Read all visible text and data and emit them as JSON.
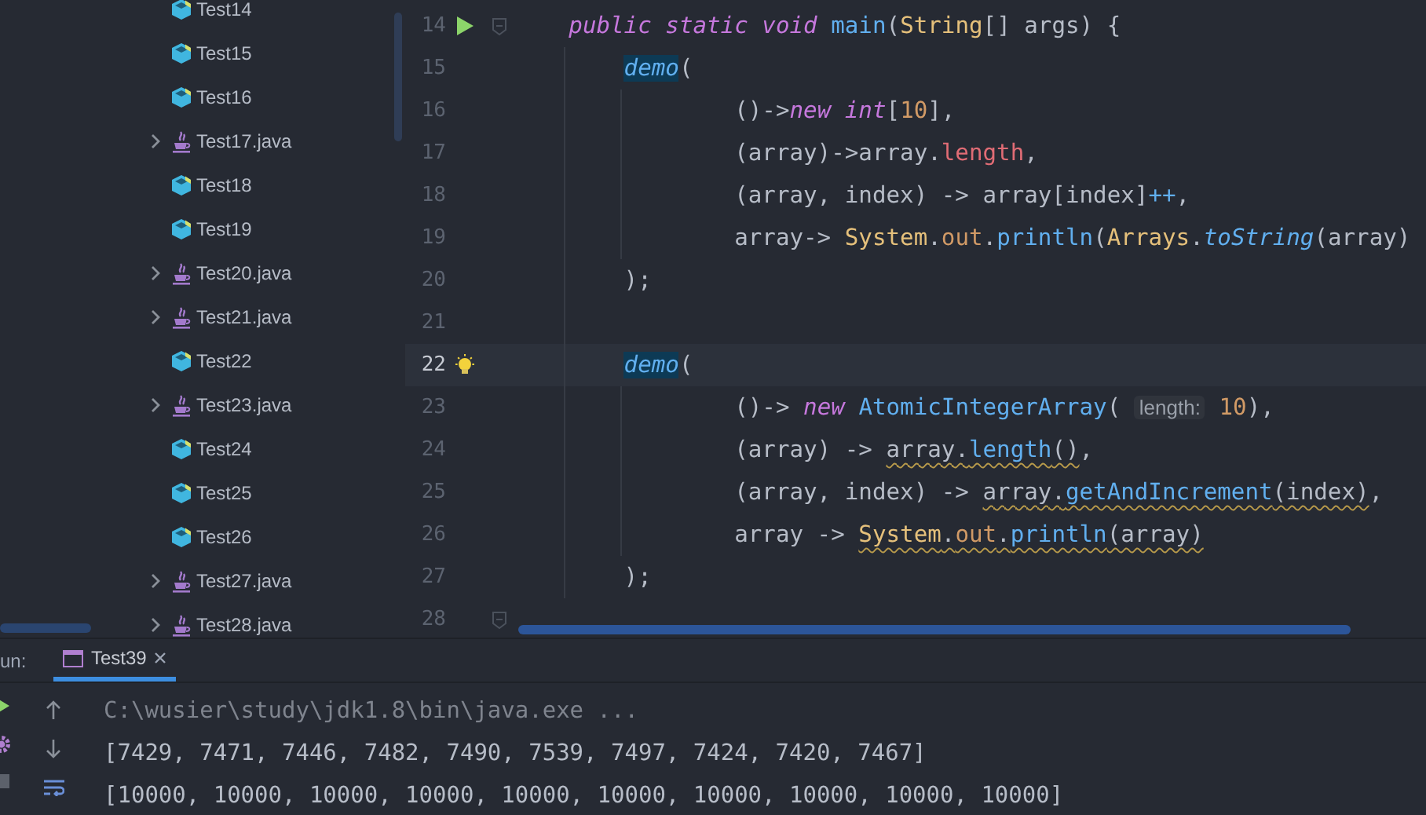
{
  "project_tree": {
    "items": [
      {
        "label": "Test14",
        "kind": "class",
        "expandable": false
      },
      {
        "label": "Test15",
        "kind": "class",
        "expandable": false
      },
      {
        "label": "Test16",
        "kind": "class",
        "expandable": false
      },
      {
        "label": "Test17.java",
        "kind": "java-file",
        "expandable": true
      },
      {
        "label": "Test18",
        "kind": "class",
        "expandable": false
      },
      {
        "label": "Test19",
        "kind": "class",
        "expandable": false
      },
      {
        "label": "Test20.java",
        "kind": "java-file",
        "expandable": true
      },
      {
        "label": "Test21.java",
        "kind": "java-file",
        "expandable": true
      },
      {
        "label": "Test22",
        "kind": "class",
        "expandable": false
      },
      {
        "label": "Test23.java",
        "kind": "java-file",
        "expandable": true
      },
      {
        "label": "Test24",
        "kind": "class",
        "expandable": false
      },
      {
        "label": "Test25",
        "kind": "class",
        "expandable": false
      },
      {
        "label": "Test26",
        "kind": "class",
        "expandable": false
      },
      {
        "label": "Test27.java",
        "kind": "java-file",
        "expandable": true
      },
      {
        "label": "Test28.java",
        "kind": "java-file",
        "expandable": true
      }
    ]
  },
  "editor": {
    "lines": [
      {
        "number": "14",
        "current": false,
        "gutter_icon": {
          "kind": "run"
        },
        "fold": true,
        "tokens": [
          {
            "text": "    public static void",
            "kind": "keyword"
          },
          {
            "text": " main",
            "kind": "method"
          },
          {
            "text": "("
          },
          {
            "text": "String",
            "kind": "type"
          },
          {
            "text": "[] args) {"
          }
        ]
      },
      {
        "number": "15",
        "current": false,
        "fold": false,
        "tokens": [
          {
            "text": "        demo",
            "kind": "static-method",
            "highlighted": true
          },
          {
            "text": "("
          }
        ]
      },
      {
        "number": "16",
        "current": false,
        "fold": false,
        "tokens": [
          {
            "text": "                ()->"
          },
          {
            "text": "new int",
            "kind": "keyword"
          },
          {
            "text": "["
          },
          {
            "text": "10",
            "kind": "number"
          },
          {
            "text": "],"
          }
        ]
      },
      {
        "number": "17",
        "current": false,
        "fold": false,
        "tokens": [
          {
            "text": "                (array)->array."
          },
          {
            "text": "length",
            "kind": "field"
          },
          {
            "text": ","
          }
        ]
      },
      {
        "number": "18",
        "current": false,
        "fold": false,
        "tokens": [
          {
            "text": "                (array, index) -> array[index]"
          },
          {
            "text": "++",
            "kind": "method"
          },
          {
            "text": ","
          }
        ]
      },
      {
        "number": "19",
        "current": false,
        "fold": false,
        "tokens": [
          {
            "text": "                array-> "
          },
          {
            "text": "System",
            "kind": "type"
          },
          {
            "text": "."
          },
          {
            "text": "out",
            "kind": "static-field"
          },
          {
            "text": "."
          },
          {
            "text": "println",
            "kind": "method"
          },
          {
            "text": "("
          },
          {
            "text": "Arrays",
            "kind": "type"
          },
          {
            "text": "."
          },
          {
            "text": "toString",
            "kind": "static-method"
          },
          {
            "text": "(array)"
          }
        ]
      },
      {
        "number": "20",
        "current": false,
        "fold": false,
        "tokens": [
          {
            "text": "        );"
          }
        ]
      },
      {
        "number": "21",
        "current": false,
        "fold": false
      },
      {
        "number": "22",
        "current": true,
        "gutter_icon": {
          "kind": "bulb"
        },
        "fold": false,
        "tokens": [
          {
            "text": "        demo",
            "kind": "static-method",
            "highlighted": true
          },
          {
            "text": "("
          }
        ]
      },
      {
        "number": "23",
        "current": false,
        "fold": false,
        "tokens": [
          {
            "text": "                ()-> "
          },
          {
            "text": "new ",
            "kind": "keyword"
          },
          {
            "text": "AtomicIntegerArray",
            "kind": "method"
          },
          {
            "text": "( "
          },
          {
            "text": "length:",
            "kind": "hint"
          },
          {
            "text": " 10",
            "kind": "number"
          },
          {
            "text": "),"
          }
        ]
      },
      {
        "number": "24",
        "current": false,
        "fold": false,
        "tokens": [
          {
            "text": "                (array) -> "
          },
          {
            "text": "array.",
            "squiggle": true
          },
          {
            "text": "length",
            "kind": "method",
            "squiggle": true
          },
          {
            "text": "()",
            "squiggle": true
          },
          {
            "text": ","
          }
        ]
      },
      {
        "number": "25",
        "current": false,
        "fold": false,
        "tokens": [
          {
            "text": "                (array, index) -> "
          },
          {
            "text": "array.",
            "squiggle": true
          },
          {
            "text": "getAndIncrement",
            "kind": "method",
            "squiggle": true
          },
          {
            "text": "(index)",
            "squiggle": true
          },
          {
            "text": ","
          }
        ]
      },
      {
        "number": "26",
        "current": false,
        "fold": false,
        "tokens": [
          {
            "text": "                array -> "
          },
          {
            "text": "System",
            "kind": "type",
            "squiggle": true
          },
          {
            "text": ".",
            "squiggle": true
          },
          {
            "text": "out",
            "kind": "static-field",
            "squiggle": true
          },
          {
            "text": ".",
            "squiggle": true
          },
          {
            "text": "println",
            "kind": "method",
            "squiggle": true
          },
          {
            "text": "(array)",
            "squiggle": true
          }
        ]
      },
      {
        "number": "27",
        "current": false,
        "fold": false,
        "tokens": [
          {
            "text": "        );"
          }
        ]
      },
      {
        "number": "28",
        "current": false,
        "fold": true
      }
    ]
  },
  "run_panel": {
    "label": "un:",
    "tabs": [
      {
        "label": "Test39",
        "selected": true
      }
    ],
    "console": [
      {
        "text": "C:\\wusier\\study\\jdk1.8\\bin\\java.exe ...",
        "kind": "command"
      },
      {
        "text": "[7429, 7471, 7446, 7482, 7490, 7539, 7497, 7424, 7420, 7467]",
        "kind": "output"
      },
      {
        "text": "[10000, 10000, 10000, 10000, 10000, 10000, 10000, 10000, 10000, 10000]",
        "kind": "output"
      }
    ]
  }
}
